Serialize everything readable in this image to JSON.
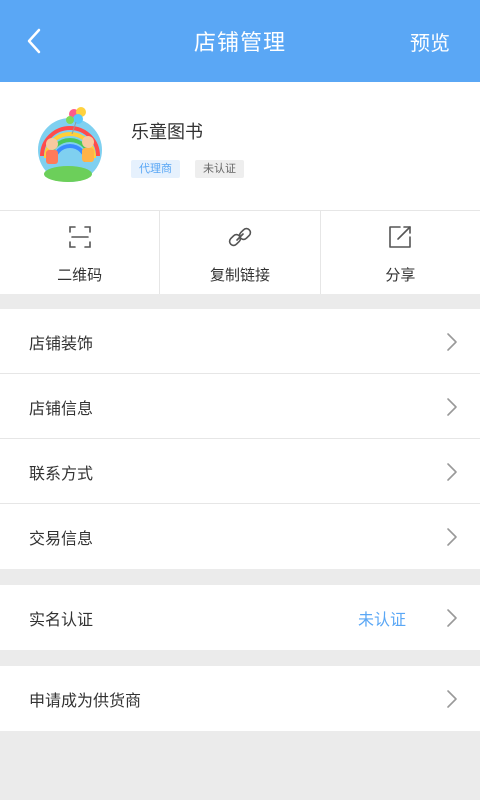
{
  "header": {
    "title": "店铺管理",
    "preview_label": "预览"
  },
  "profile": {
    "shop_name": "乐童图书",
    "badge_agent": "代理商",
    "badge_status": "未认证"
  },
  "actions": [
    {
      "label": "二维码",
      "icon": "qr-scan-icon"
    },
    {
      "label": "复制链接",
      "icon": "link-icon"
    },
    {
      "label": "分享",
      "icon": "share-edit-icon"
    }
  ],
  "menu_group1": [
    {
      "label": "店铺装饰"
    },
    {
      "label": "店铺信息"
    },
    {
      "label": "联系方式"
    },
    {
      "label": "交易信息"
    }
  ],
  "menu_group2": [
    {
      "label": "实名认证",
      "value": "未认证"
    }
  ],
  "menu_group3": [
    {
      "label": "申请成为供货商"
    }
  ],
  "colors": {
    "accent": "#5aa7f5",
    "background": "#ebebeb",
    "divider": "#e6e6e6"
  }
}
